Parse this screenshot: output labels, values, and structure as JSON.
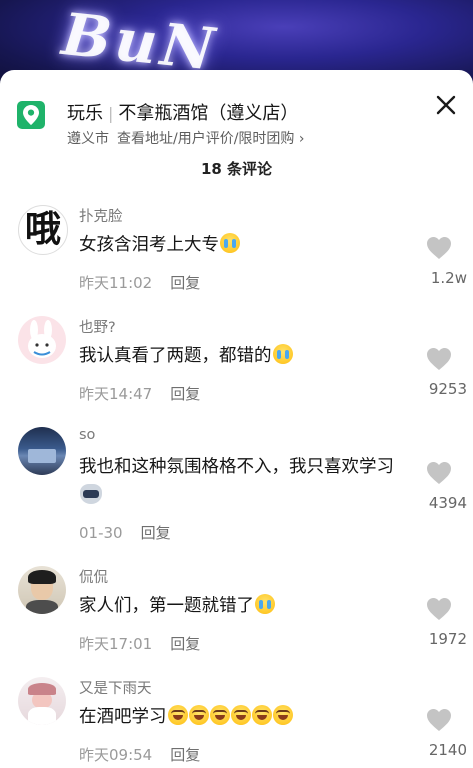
{
  "poi": {
    "category": "玩乐",
    "name": "不拿瓶酒馆（遵义店）",
    "city": "遵义市",
    "links": "查看地址/用户评价/限时团购 ›"
  },
  "comment_count": "18 条评论",
  "comments": [
    {
      "user": "扑克脸",
      "text": "女孩含泪考上大专",
      "emoji": "cry-emoji",
      "time": "昨天11:02",
      "reply": "回复",
      "likes": "1.2w",
      "avatar_text": "哦"
    },
    {
      "user": "也野?",
      "text": "我认真看了两题，都错的",
      "emoji": "cry-emoji",
      "time": "昨天14:47",
      "reply": "回复",
      "likes": "9253"
    },
    {
      "user": "so",
      "text": "我也和这种氛围格格不入，我只喜欢学习",
      "emoji": "cat-emoji",
      "time": "01-30",
      "reply": "回复",
      "likes": "4394"
    },
    {
      "user": "侃侃",
      "text": "家人们，第一题就错了",
      "emoji": "cry-emoji",
      "time": "昨天17:01",
      "reply": "回复",
      "likes": "1972"
    },
    {
      "user": "又是下雨天",
      "text": "在酒吧学习",
      "emoji": "laugh-emoji x6",
      "time": "昨天09:54",
      "reply": "回复",
      "likes": "2140"
    }
  ],
  "colors": {
    "accent": "#1fb36a",
    "sheet_bg": "#ffffff",
    "muted": "#9a9a9a",
    "like_gray": "#c4c4c4"
  }
}
